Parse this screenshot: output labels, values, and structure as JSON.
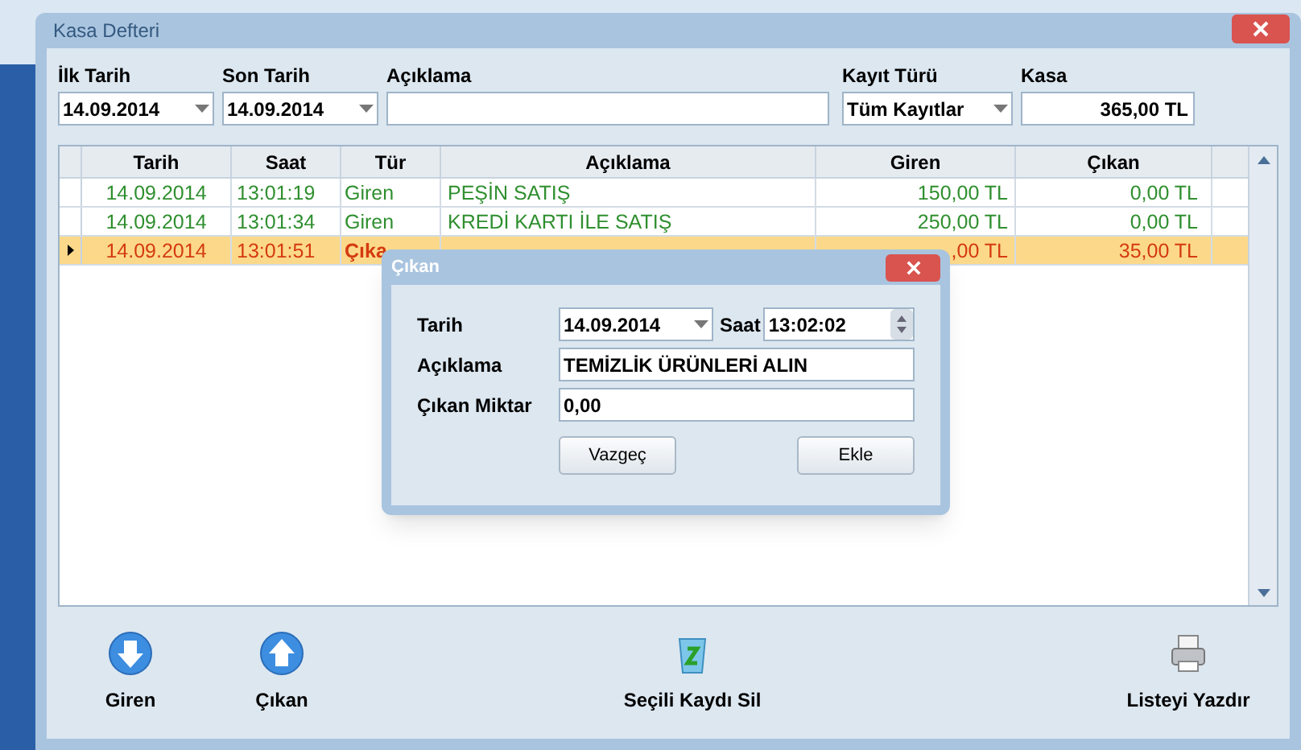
{
  "window": {
    "title": "Kasa Defteri"
  },
  "filters": [
    {
      "label": "İlk Tarih",
      "value": "14.09.2014",
      "kind": "dropdown"
    },
    {
      "label": "Son Tarih",
      "value": "14.09.2014",
      "kind": "dropdown"
    },
    {
      "label": "Açıklama",
      "kind": "text"
    },
    {
      "label": "Kayıt Türü",
      "value": "Tüm Kayıtlar",
      "kind": "dropdown"
    },
    {
      "label": "Kasa",
      "value": "365,00 TL",
      "kind": "amount"
    }
  ],
  "table": {
    "columns": [
      "Tarih",
      "Saat",
      "Tür",
      "Açıklama",
      "Giren",
      "Çıkan"
    ],
    "rows": [
      {
        "kind": "giren",
        "selected": false,
        "cells": [
          "14.09.2014",
          "13:01:19",
          "Giren",
          "PEŞİN SATIŞ",
          "150,00 TL",
          "0,00 TL"
        ]
      },
      {
        "kind": "giren",
        "selected": false,
        "cells": [
          "14.09.2014",
          "13:01:34",
          "Giren",
          "KREDİ KARTI İLE SATIŞ",
          "250,00 TL",
          "0,00 TL"
        ]
      },
      {
        "kind": "cikan",
        "selected": true,
        "cells": [
          "14.09.2014",
          "13:01:51",
          "Çıka",
          "",
          ",00 TL",
          "35,00 TL"
        ]
      }
    ]
  },
  "toolbar": [
    {
      "label": "Giren"
    },
    {
      "label": "Çıkan"
    },
    {
      "label": "Seçili Kaydı Sil"
    },
    {
      "label": "Listeyi Yazdır"
    }
  ],
  "dialog": {
    "title": "Çıkan",
    "date_label": "Tarih",
    "date": "14.09.2014",
    "time_label": "Saat",
    "time": "13:02:02",
    "desc_label": "Açıklama",
    "desc": "TEMİZLİK ÜRÜNLERİ ALIN",
    "amount_label": "Çıkan Miktar",
    "amount": "0,00",
    "buttons": [
      "Vazgeç",
      "Ekle"
    ]
  }
}
